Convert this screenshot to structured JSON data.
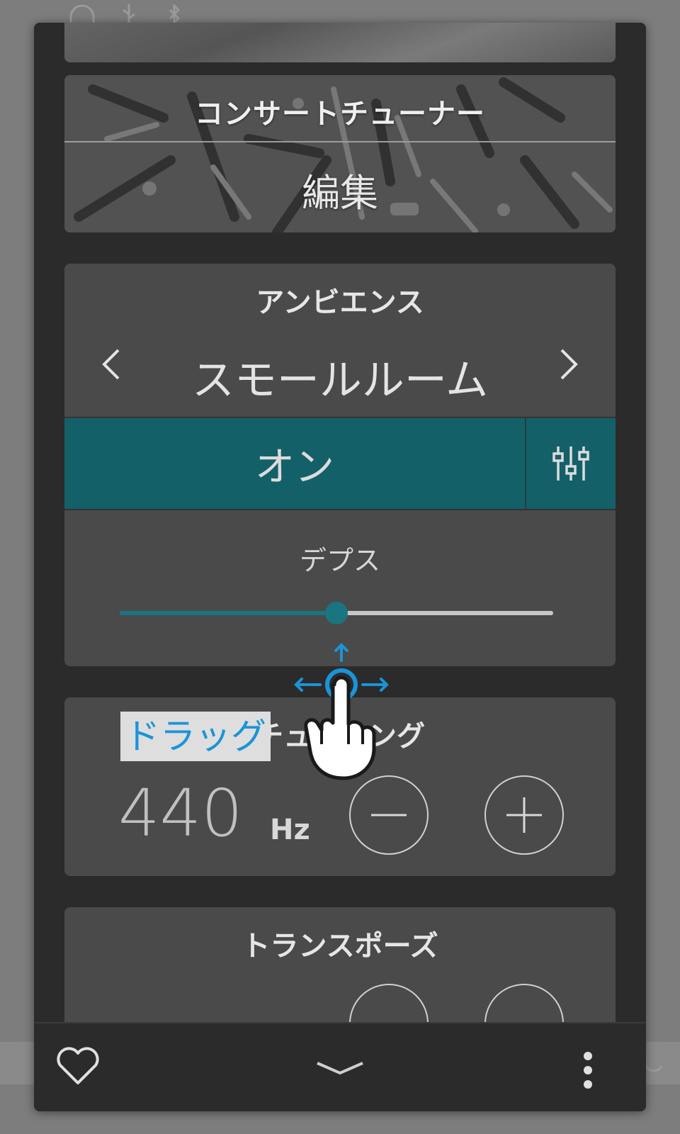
{
  "colors": {
    "accent_teal": "#146068",
    "slider_teal": "#197580",
    "card_bg": "#4a4a4a",
    "panel_bg": "#2b2b2b",
    "gesture_blue": "#1a94d8"
  },
  "background_icons": [
    "headphones-icon",
    "usb-icon",
    "bluetooth-icon"
  ],
  "concert_tuner": {
    "title": "コンサートチューナー",
    "edit_label": "編集"
  },
  "ambience": {
    "title": "アンビエンス",
    "preset": "スモールルーム",
    "toggle_label": "オン",
    "depth_label": "デプス",
    "depth_level": 0.5,
    "prev_icon": "chevron-left-icon",
    "next_icon": "chevron-right-icon",
    "settings_icon": "equalizer-icon"
  },
  "tuning": {
    "title": "チューニング",
    "value": "440",
    "unit": "Hz",
    "decrease_icon": "minus-icon",
    "increase_icon": "plus-icon"
  },
  "transpose": {
    "title": "トランスポーズ"
  },
  "bottom_bar": {
    "favorite_icon": "heart-icon",
    "collapse_icon": "chevron-down-icon",
    "more_icon": "more-vertical-icon"
  },
  "gesture_hint": {
    "label": "ドラッグ",
    "icon": "drag-hand-icon"
  }
}
